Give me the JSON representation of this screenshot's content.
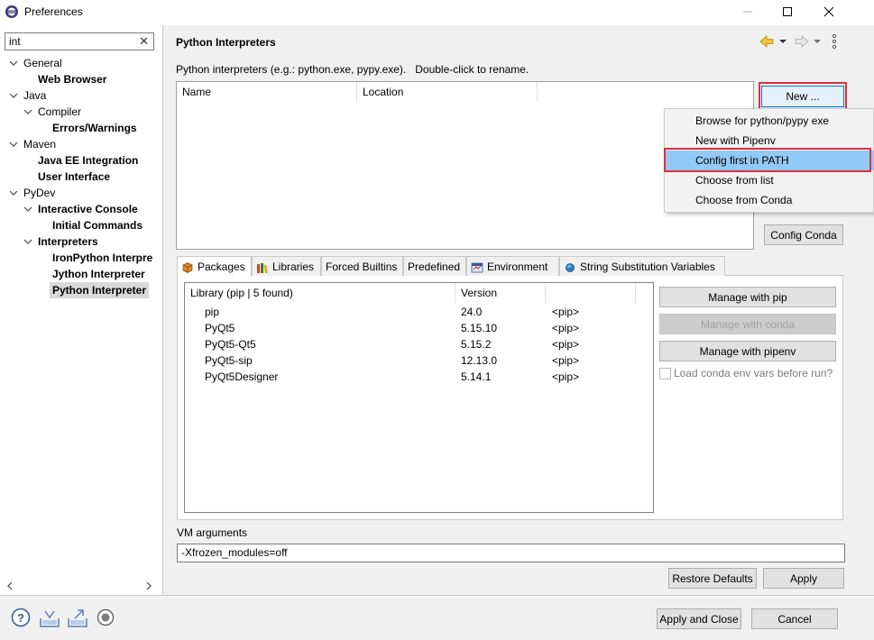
{
  "window": {
    "title": "Preferences"
  },
  "sidebar": {
    "filter_value": "int",
    "tree": [
      {
        "label": "General",
        "level": 0,
        "expanded": true,
        "bold": false
      },
      {
        "label": "Web Browser",
        "level": 1,
        "expanded": null,
        "bold": true
      },
      {
        "label": "Java",
        "level": 0,
        "expanded": true,
        "bold": false
      },
      {
        "label": "Compiler",
        "level": 1,
        "expanded": true,
        "bold": false
      },
      {
        "label": "Errors/Warnings",
        "level": 2,
        "expanded": null,
        "bold": true
      },
      {
        "label": "Maven",
        "level": 0,
        "expanded": true,
        "bold": false
      },
      {
        "label": "Java EE Integration",
        "level": 1,
        "expanded": null,
        "bold": true
      },
      {
        "label": "User Interface",
        "level": 1,
        "expanded": null,
        "bold": true
      },
      {
        "label": "PyDev",
        "level": 0,
        "expanded": true,
        "bold": false
      },
      {
        "label": "Interactive Console",
        "level": 1,
        "expanded": true,
        "bold": true
      },
      {
        "label": "Initial Commands",
        "level": 2,
        "expanded": null,
        "bold": true
      },
      {
        "label": "Interpreters",
        "level": 1,
        "expanded": true,
        "bold": true
      },
      {
        "label": "IronPython Interpre",
        "level": 2,
        "expanded": null,
        "bold": true
      },
      {
        "label": "Jython Interpreter",
        "level": 2,
        "expanded": null,
        "bold": true
      },
      {
        "label": "Python Interpreter",
        "level": 2,
        "expanded": null,
        "bold": true,
        "selected": true
      }
    ]
  },
  "page": {
    "title": "Python Interpreters",
    "description": "Python interpreters (e.g.: python.exe, pypy.exe).   Double-click to rename.",
    "interpreters_table": {
      "columns": [
        "Name",
        "Location"
      ]
    },
    "new_button": "New ...",
    "config_conda_button": "Config Conda",
    "new_menu": [
      {
        "label": "Browse for python/pypy exe",
        "highlighted": false
      },
      {
        "label": "New with Pipenv",
        "highlighted": false
      },
      {
        "label": "Config first in PATH",
        "highlighted": true
      },
      {
        "label": "Choose from list",
        "highlighted": false
      },
      {
        "label": "Choose from Conda",
        "highlighted": false
      }
    ],
    "tabs": [
      {
        "label": "Packages",
        "icon": "package-icon",
        "active": true
      },
      {
        "label": "Libraries",
        "icon": "libraries-icon",
        "active": false
      },
      {
        "label": "Forced Builtins",
        "icon": "",
        "active": false
      },
      {
        "label": "Predefined",
        "icon": "",
        "active": false
      },
      {
        "label": "Environment",
        "icon": "environment-icon",
        "active": false
      },
      {
        "label": "String Substitution Variables",
        "icon": "variables-icon",
        "active": false
      }
    ],
    "packages": {
      "columns": [
        "Library (pip | 5 found)",
        "Version"
      ],
      "rows": [
        {
          "name": "pip",
          "version": "24.0",
          "source": "<pip>"
        },
        {
          "name": "PyQt5",
          "version": "5.15.10",
          "source": "<pip>"
        },
        {
          "name": "PyQt5-Qt5",
          "version": "5.15.2",
          "source": "<pip>"
        },
        {
          "name": "PyQt5-sip",
          "version": "12.13.0",
          "source": "<pip>"
        },
        {
          "name": "PyQt5Designer",
          "version": "5.14.1",
          "source": "<pip>"
        }
      ],
      "manage_pip": "Manage with pip",
      "manage_conda": "Manage with conda",
      "manage_pipenv": "Manage with pipenv",
      "load_conda_env": "Load conda env vars before run?"
    },
    "vm_arguments": {
      "label": "VM arguments",
      "value": "-Xfrozen_modules=off"
    },
    "restore_defaults": "Restore Defaults",
    "apply": "Apply"
  },
  "footer": {
    "apply_and_close": "Apply and Close",
    "cancel": "Cancel"
  },
  "colors": {
    "selection": "#91c9f7",
    "annotation_red": "#e0303a",
    "focus_blue": "#0078d7"
  }
}
